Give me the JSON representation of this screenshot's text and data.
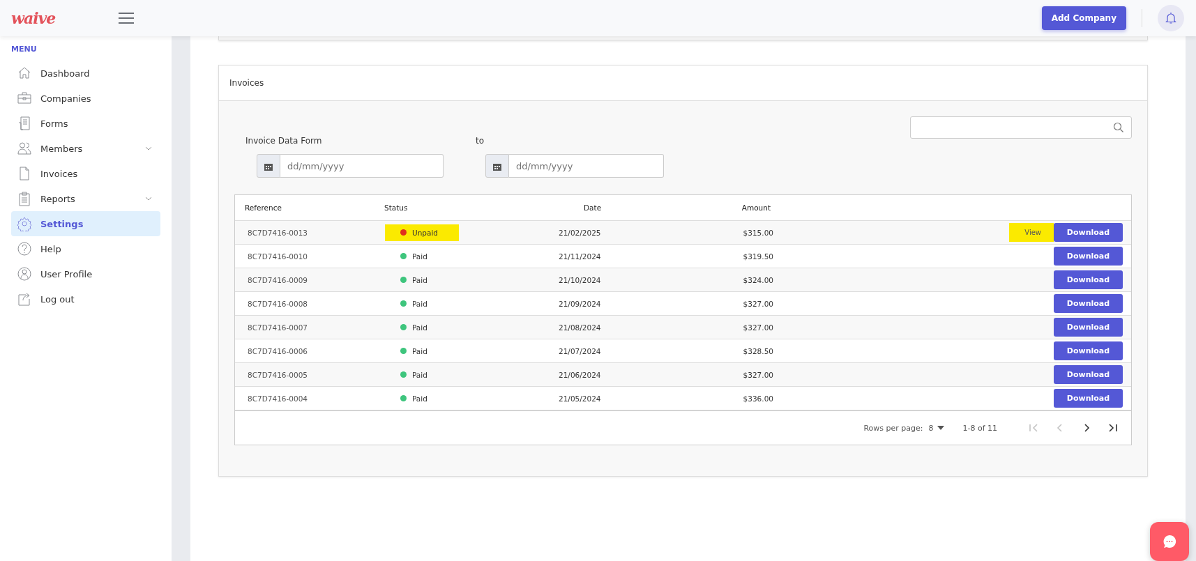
{
  "header": {
    "logo": "waive",
    "add_button": "Add Company"
  },
  "sidebar": {
    "heading": "MENU",
    "items": [
      {
        "label": "Dashboard",
        "selected": false,
        "expandable": false
      },
      {
        "label": "Companies",
        "selected": false,
        "expandable": false
      },
      {
        "label": "Forms",
        "selected": false,
        "expandable": false
      },
      {
        "label": "Members",
        "selected": false,
        "expandable": true
      },
      {
        "label": "Invoices",
        "selected": false,
        "expandable": false
      },
      {
        "label": "Reports",
        "selected": false,
        "expandable": true
      },
      {
        "label": "Settings",
        "selected": true,
        "expandable": false
      },
      {
        "label": "Help",
        "selected": false,
        "expandable": false
      },
      {
        "label": "User Profile",
        "selected": false,
        "expandable": false
      },
      {
        "label": "Log out",
        "selected": false,
        "expandable": false
      }
    ]
  },
  "invoices": {
    "title": "Invoices",
    "filters": [
      {
        "label": "Invoice Data Form",
        "placeholder": "dd/mm/yyyy"
      },
      {
        "label": "to",
        "placeholder": "dd/mm/yyyy"
      }
    ],
    "table": {
      "columns": [
        "Reference",
        "Status",
        "Date",
        "Amount"
      ],
      "rows": [
        {
          "reference": "8C7D7416-0013",
          "status": "Unpaid",
          "paid": false,
          "date": "21/02/2025",
          "amount": "$315.00",
          "view": "View",
          "highlighted": true,
          "action": "Download"
        },
        {
          "reference": "8C7D7416-0010",
          "status": "Paid",
          "paid": true,
          "date": "21/11/2024",
          "amount": "$319.50",
          "highlighted": false,
          "action": "Download"
        },
        {
          "reference": "8C7D7416-0009",
          "status": "Paid",
          "paid": true,
          "date": "21/10/2024",
          "amount": "$324.00",
          "highlighted": false,
          "action": "Download"
        },
        {
          "reference": "8C7D7416-0008",
          "status": "Paid",
          "paid": true,
          "date": "21/09/2024",
          "amount": "$327.00",
          "highlighted": false,
          "action": "Download"
        },
        {
          "reference": "8C7D7416-0007",
          "status": "Paid",
          "paid": true,
          "date": "21/08/2024",
          "amount": "$327.00",
          "highlighted": false,
          "action": "Download"
        },
        {
          "reference": "8C7D7416-0006",
          "status": "Paid",
          "paid": true,
          "date": "21/07/2024",
          "amount": "$328.50",
          "highlighted": false,
          "action": "Download"
        },
        {
          "reference": "8C7D7416-0005",
          "status": "Paid",
          "paid": true,
          "date": "21/06/2024",
          "amount": "$327.00",
          "highlighted": false,
          "action": "Download"
        },
        {
          "reference": "8C7D7416-0004",
          "status": "Paid",
          "paid": true,
          "date": "21/05/2024",
          "amount": "$336.00",
          "highlighted": false,
          "action": "Download"
        }
      ]
    },
    "pagination": {
      "rows_label": "Rows per page:",
      "rows_value": "8",
      "range": "1-8 of 11",
      "first_disabled": true,
      "prev_disabled": true,
      "next_disabled": false,
      "last_disabled": false
    }
  }
}
